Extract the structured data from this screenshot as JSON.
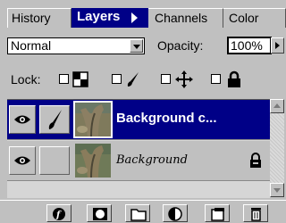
{
  "tabs": {
    "history": "History",
    "layers": "Layers",
    "channels": "Channels",
    "color": "Color"
  },
  "blend": {
    "mode": "Normal"
  },
  "opacity": {
    "label": "Opacity:",
    "value": "100%"
  },
  "lock": {
    "label": "Lock:"
  },
  "layers": [
    {
      "name": "Background c...",
      "selected": true,
      "visible": true
    },
    {
      "name": "Background",
      "selected": false,
      "visible": true,
      "locked": true
    }
  ],
  "colors": {
    "accent": "#000087",
    "panel": "#c0c0c0"
  },
  "icons": [
    "eye-icon",
    "brush-icon",
    "lock-transparency-icon",
    "lock-paint-icon",
    "lock-move-icon",
    "lock-all-icon",
    "layer-style-icon",
    "layer-mask-icon",
    "new-set-icon",
    "adjustment-layer-icon",
    "new-layer-icon",
    "trash-icon"
  ]
}
